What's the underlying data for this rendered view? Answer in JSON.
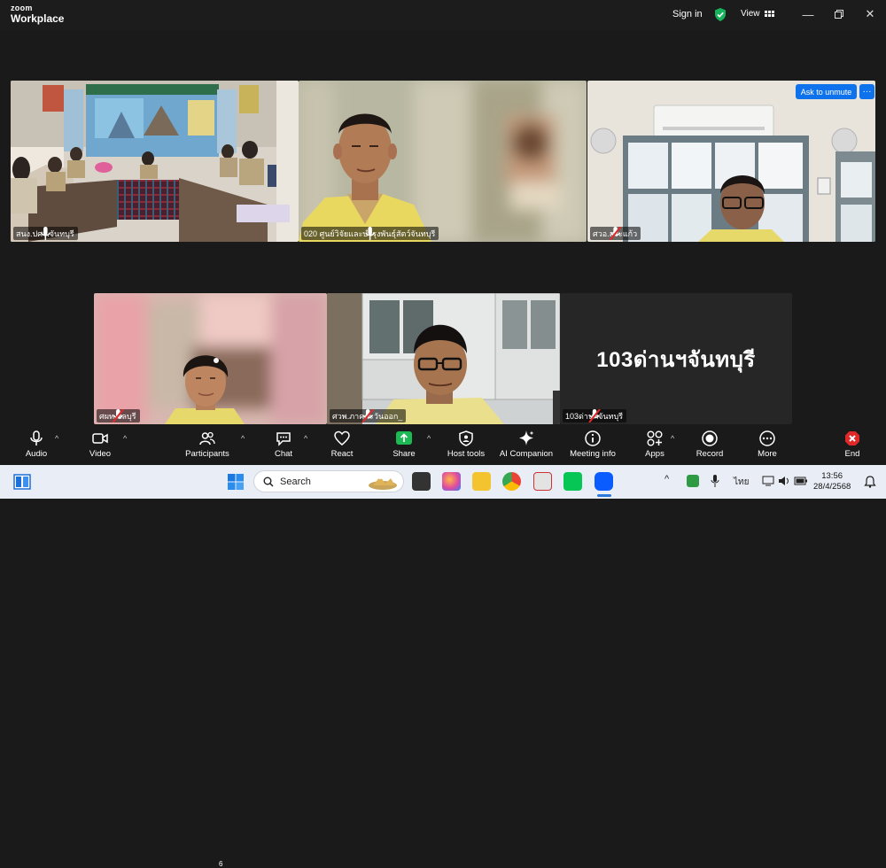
{
  "titlebar": {
    "logo_top": "zoom",
    "logo_bottom": "Workplace",
    "signin": "Sign in",
    "view": "View"
  },
  "participants": [
    {
      "name": "สนง.ปศจ.จันทบุรี",
      "muted": false
    },
    {
      "name": "020 ศูนย์วิจัยและบำรุงพันธุ์สัตว์จันทบุรี",
      "muted": false
    },
    {
      "name": "ศวอ.สระแก้ว",
      "muted": true
    },
    {
      "name": "ศผท.ชลบุรี",
      "muted": true
    },
    {
      "name": "ศวพ.ภาคตะวันออก_",
      "muted": true
    },
    {
      "name": "103ด่านฯจันทบุรี",
      "muted": true
    }
  ],
  "unmute": {
    "label": "Ask to unmute",
    "more": "···"
  },
  "no_video_name": "103ด่านฯจันทบุรี",
  "toolbar": {
    "audio": "Audio",
    "video": "Video",
    "participants": "Participants",
    "participants_count": "6",
    "chat": "Chat",
    "react": "React",
    "share": "Share",
    "host_tools": "Host tools",
    "ai_companion": "AI Companion",
    "meeting_info": "Meeting info",
    "apps": "Apps",
    "record": "Record",
    "more": "More",
    "end": "End"
  },
  "taskbar": {
    "search": "Search",
    "lang": "ไทย",
    "time": "13:56",
    "date": "28/4/2568"
  },
  "colors": {
    "active_speaker": "#2fd07a",
    "unmute_button": "#0e72ed",
    "share_green": "#1db954",
    "end_red": "#e02828"
  }
}
